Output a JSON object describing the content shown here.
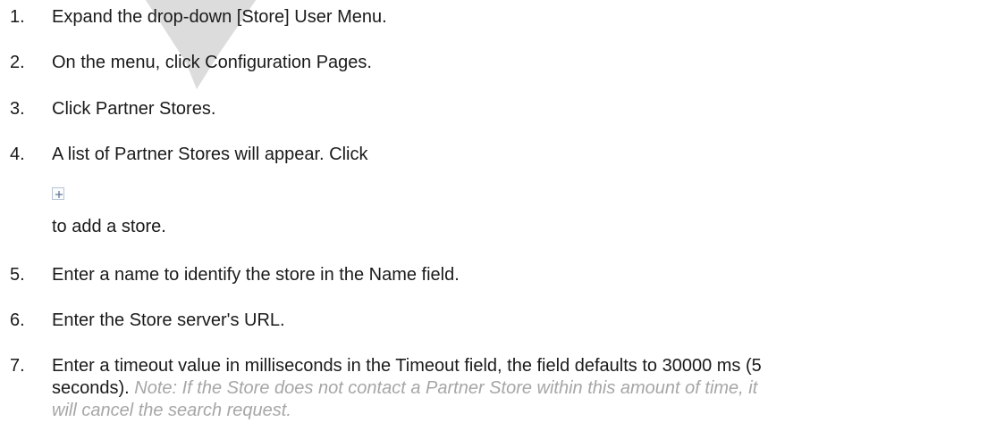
{
  "steps": [
    {
      "num": "1.",
      "text": "Expand the drop-down [Store] User Menu."
    },
    {
      "num": "2.",
      "text": "On the menu, click Configuration Pages."
    },
    {
      "num": "3.",
      "text": "Click Partner Stores."
    },
    {
      "num": "4.",
      "text": "A list of Partner Stores will appear. Click",
      "text_after_icon": "to add a store.",
      "icon": "add-icon"
    },
    {
      "num": "5.",
      "text": "Enter a name to identify the store in the Name field."
    },
    {
      "num": "6.",
      "text": "Enter the Store server's URL."
    },
    {
      "num": "7.",
      "line1": "Enter a timeout value in milliseconds in the Timeout field, the field defaults to 30000 ms (5",
      "line2_plain": "seconds).",
      "note": " Note: If the Store does not contact a Partner Store within this amount of time, it",
      "line3_note": "will cancel the search request."
    }
  ],
  "colors": {
    "text": "#1a1a1a",
    "note": "#a6a6a6",
    "watermark": "#d9d9d9"
  }
}
